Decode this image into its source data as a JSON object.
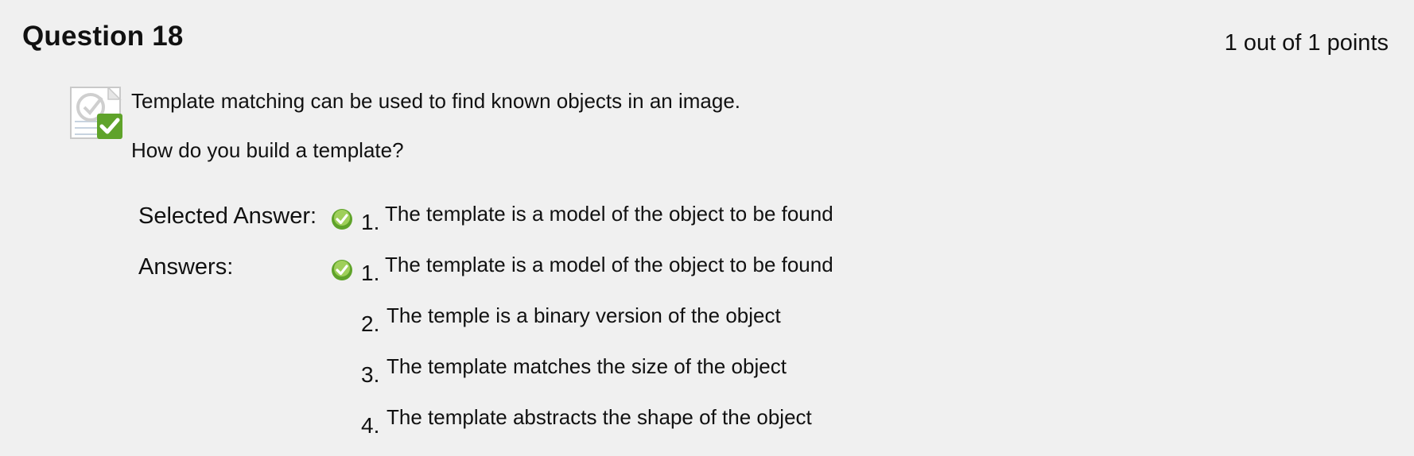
{
  "question": {
    "title": "Question 18",
    "points": "1 out of 1 points",
    "status_icon": "correct-check-icon",
    "text_line_1": "Template matching can be used to find known objects in an image.",
    "text_line_2": "How do you build a template?"
  },
  "selected": {
    "label": "Selected Answer:",
    "number": "1.",
    "text": "The template is a model of the object to be found",
    "icon": "correct-check-icon"
  },
  "answers": {
    "label": "Answers:",
    "items": [
      {
        "number": "1.",
        "text": "The template is a model of the object to be found",
        "correct": true
      },
      {
        "number": "2.",
        "text": "The temple is a binary version of the object",
        "correct": false
      },
      {
        "number": "3.",
        "text": "The template matches the size of the object",
        "correct": false
      },
      {
        "number": "4.",
        "text": "The template abstracts the shape of the object",
        "correct": false
      }
    ]
  },
  "colors": {
    "background": "#f0f0f0",
    "check_green": "#5fa32a",
    "check_green_light": "#9fcf5a"
  }
}
